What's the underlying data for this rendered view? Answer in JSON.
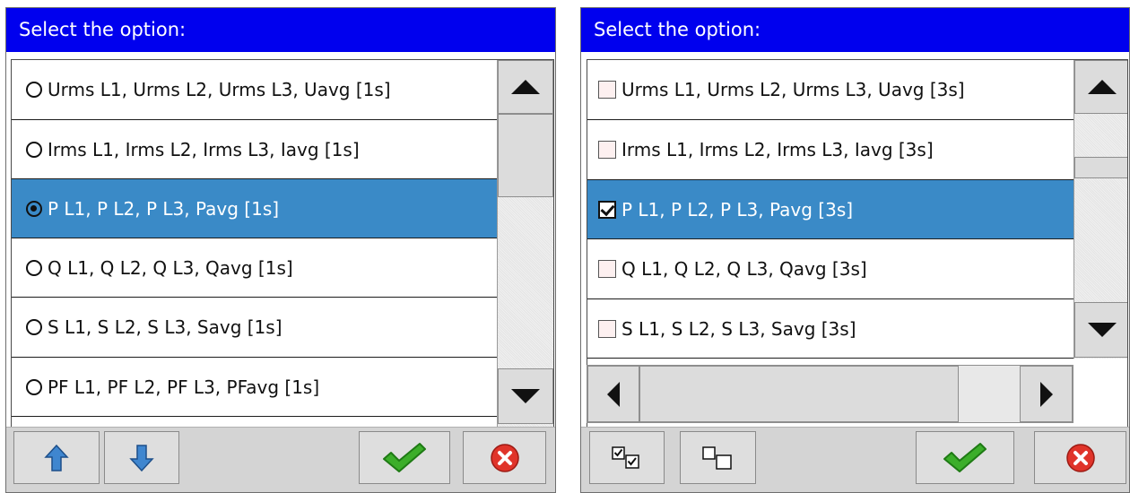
{
  "dialog_radio": {
    "title": "Select the option:",
    "options": [
      {
        "label": "Urms L1, Urms L2, Urms L3, Uavg [1s]",
        "selected": false
      },
      {
        "label": "Irms L1, Irms L2, Irms L3, Iavg [1s]",
        "selected": false
      },
      {
        "label": "P L1, P L2, P L3, Pavg [1s]",
        "selected": true
      },
      {
        "label": "Q L1, Q L2, Q L3, Qavg [1s]",
        "selected": false
      },
      {
        "label": "S L1, S L2, S L3, Savg [1s]",
        "selected": false
      },
      {
        "label": "PF L1, PF L2, PF L3, PFavg [1s]",
        "selected": false
      }
    ],
    "buttons": {
      "move_up": "arrow-up-icon",
      "move_down": "arrow-down-icon",
      "ok": "green-check-icon",
      "cancel": "red-x-icon"
    }
  },
  "dialog_checkbox": {
    "title": "Select the option:",
    "options": [
      {
        "label": "Urms L1, Urms L2, Urms L3, Uavg [3s]",
        "checked": false
      },
      {
        "label": "Irms L1, Irms L2, Irms L3, Iavg [3s]",
        "checked": false
      },
      {
        "label": "P L1, P L2, P L3, Pavg [3s]",
        "checked": true
      },
      {
        "label": "Q L1, Q L2, Q L3, Qavg [3s]",
        "checked": false
      },
      {
        "label": "S L1, S L2, S L3, Savg [3s]",
        "checked": false
      }
    ],
    "buttons": {
      "select_all": "select-all-icon",
      "deselect_all": "deselect-all-icon",
      "ok": "green-check-icon",
      "cancel": "red-x-icon"
    }
  },
  "colors": {
    "titlebar": "#0000ee",
    "selection": "#3a8ac7",
    "ok_green": "#3cae2a",
    "cancel_red": "#e0342a",
    "arrow_blue": "#3f86cf"
  }
}
